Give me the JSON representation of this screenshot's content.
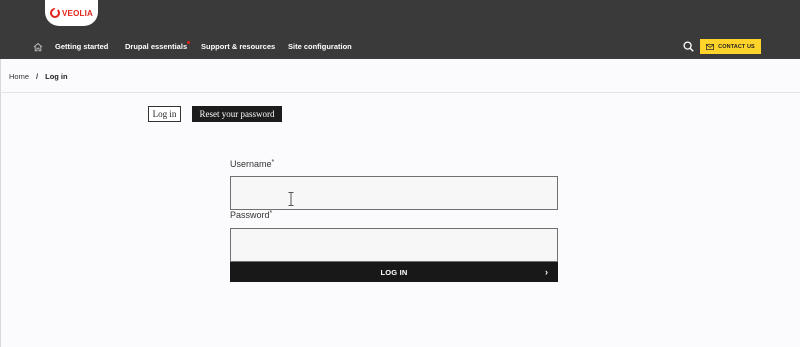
{
  "header": {
    "logo_text": "VEOLIA",
    "nav": [
      {
        "label": "Getting started"
      },
      {
        "label": "Drupal essentials"
      },
      {
        "label": "Support & resources"
      },
      {
        "label": "Site configuration"
      }
    ],
    "contact_label": "CONTACT US"
  },
  "breadcrumb": {
    "home": "Home",
    "separator": "/",
    "current": "Log in"
  },
  "tabs": {
    "login": "Log in",
    "reset": "Reset your password"
  },
  "form": {
    "username_label": "Username",
    "password_label": "Password",
    "required_mark": "*",
    "username_value": "",
    "password_value": "",
    "submit_label": "LOG IN",
    "submit_chevron": "›"
  },
  "colors": {
    "header_bg": "#3a3a3a",
    "brand_red": "#e2231a",
    "contact_yellow": "#ffd42a",
    "button_dark": "#181818"
  },
  "icons": [
    "home-icon",
    "search-icon",
    "mail-icon",
    "text-cursor-icon",
    "chevron-right-icon"
  ]
}
